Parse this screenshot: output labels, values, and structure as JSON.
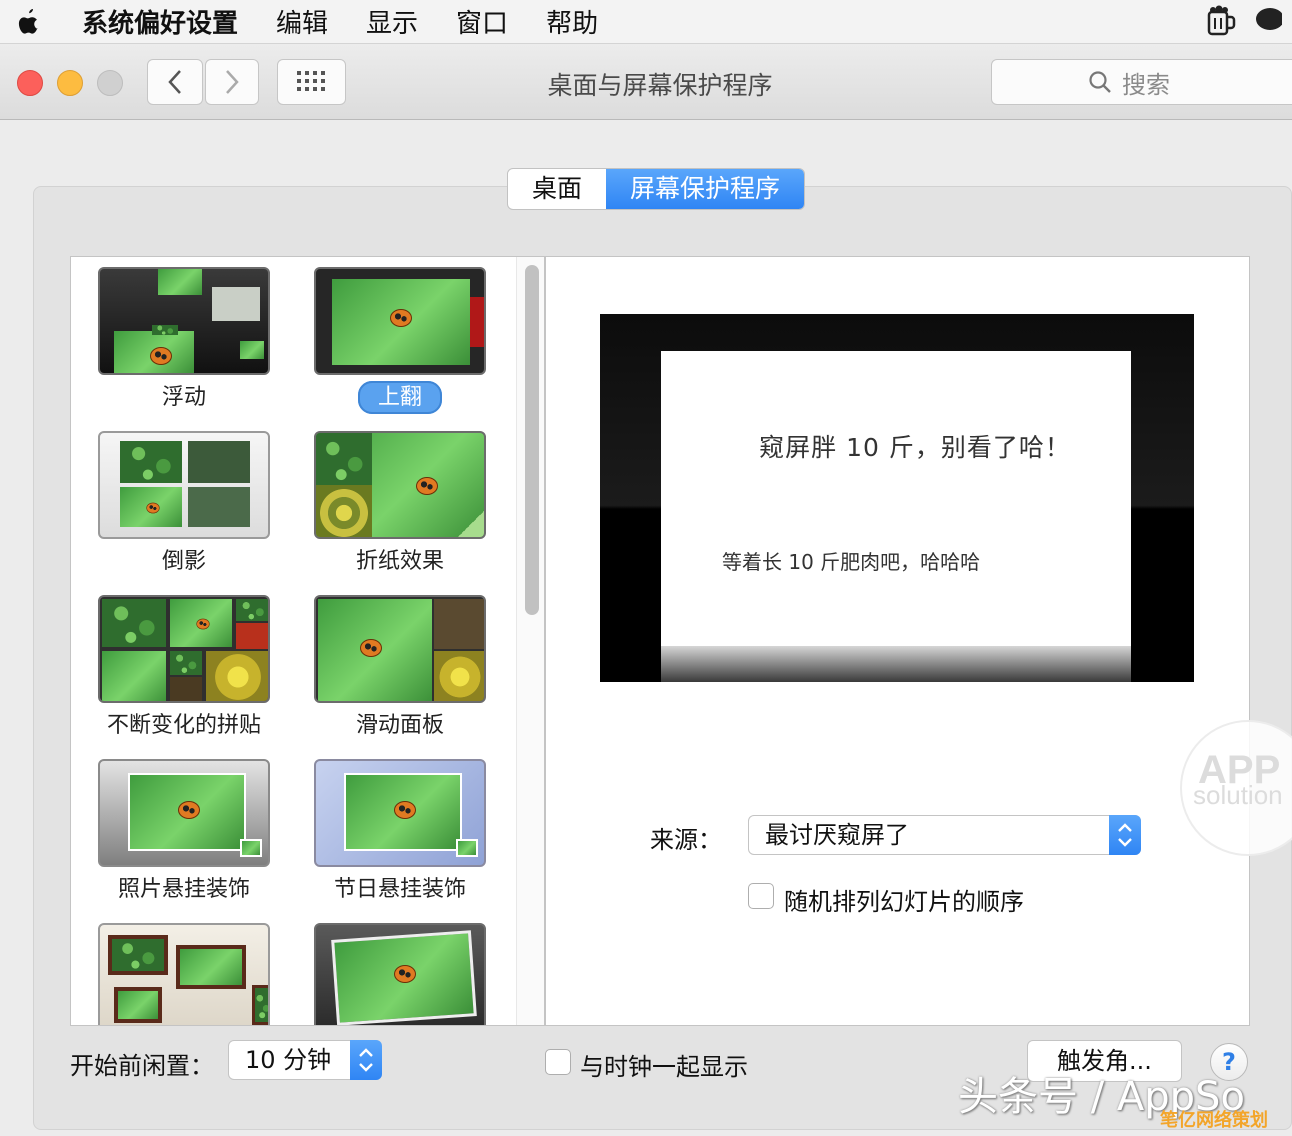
{
  "menubar": {
    "app": "系统偏好设置",
    "items": [
      "编辑",
      "显示",
      "窗口",
      "帮助"
    ]
  },
  "window": {
    "title": "桌面与屏幕保护程序",
    "search_placeholder": "搜索"
  },
  "tabs": [
    {
      "label": "桌面",
      "active": false
    },
    {
      "label": "屏幕保护程序",
      "active": true
    }
  ],
  "screensavers": [
    {
      "label": "浮动"
    },
    {
      "label": "上翻",
      "selected": true
    },
    {
      "label": "倒影"
    },
    {
      "label": "折纸效果"
    },
    {
      "label": "不断变化的拼贴"
    },
    {
      "label": "滑动面板"
    },
    {
      "label": "照片悬挂装饰"
    },
    {
      "label": "节日悬挂装饰"
    }
  ],
  "preview": {
    "title": "窥屏胖 10 斤，别看了哈！",
    "subtitle": "等着长 10 斤肥肉吧，哈哈哈"
  },
  "source": {
    "label": "来源：",
    "value": "最讨厌窥屏了"
  },
  "shuffle": {
    "label": "随机排列幻灯片的顺序",
    "checked": false
  },
  "idle": {
    "label": "开始前闲置：",
    "value": "10 分钟"
  },
  "clock": {
    "label": "与时钟一起显示",
    "checked": false
  },
  "hot_corners_label": "触发角...",
  "help_label": "?",
  "watermarks": {
    "app": "APP",
    "solution": "solution",
    "toutiao": "头条号 / AppSo",
    "corner": "笔亿网络策划"
  },
  "colors": {
    "accent": "#2f85f4",
    "selected_label": "#5aa2ef"
  }
}
